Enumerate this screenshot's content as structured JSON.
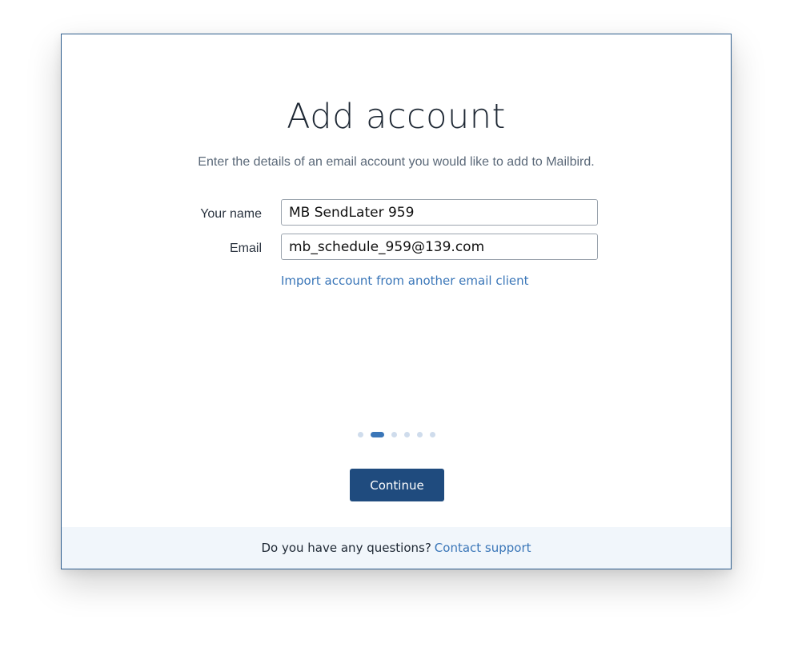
{
  "dialog": {
    "title": "Add account",
    "subtitle": "Enter the details of an email account you would like to add to Mailbird."
  },
  "form": {
    "name_label": "Your name",
    "name_value": "MB SendLater 959",
    "email_label": "Email",
    "email_value": "mb_schedule_959@139.com",
    "import_link": "Import account from another email client"
  },
  "progress": {
    "total_steps": 6,
    "current_step": 2
  },
  "actions": {
    "continue_label": "Continue"
  },
  "footer": {
    "question": "Do you have any questions?",
    "support_link": "Contact support"
  },
  "colors": {
    "accent": "#3a76b8",
    "button": "#1f4b7e",
    "footer_bg": "#f1f6fb",
    "border": "#2f5e8e"
  }
}
